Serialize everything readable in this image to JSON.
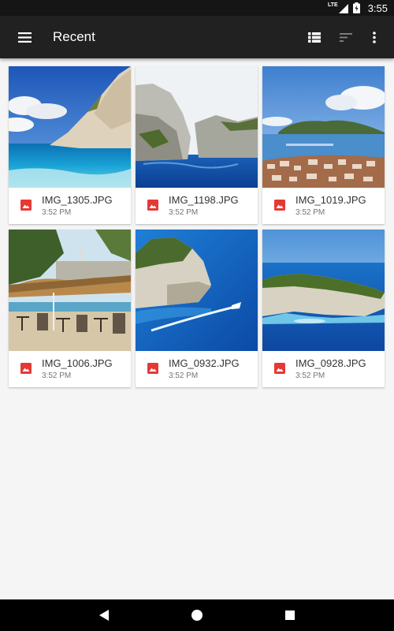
{
  "status_bar": {
    "network": "LTE",
    "time": "3:55"
  },
  "app_bar": {
    "title": "Recent"
  },
  "files": [
    {
      "name": "IMG_1305.JPG",
      "time": "3:52 PM",
      "scene": "beach-cliff"
    },
    {
      "name": "IMG_1198.JPG",
      "time": "3:52 PM",
      "scene": "cliffs-bay"
    },
    {
      "name": "IMG_1019.JPG",
      "time": "3:52 PM",
      "scene": "harbor-town"
    },
    {
      "name": "IMG_1006.JPG",
      "time": "3:52 PM",
      "scene": "cafe-terrace"
    },
    {
      "name": "IMG_0932.JPG",
      "time": "3:52 PM",
      "scene": "boat-sea"
    },
    {
      "name": "IMG_0928.JPG",
      "time": "3:52 PM",
      "scene": "shipwreck-cove"
    }
  ],
  "icons": {
    "file_type": "image-icon",
    "file_type_color": "#e53935"
  },
  "colors": {
    "app_bar": "#212121",
    "status_bar": "#151515",
    "background": "#f5f5f5",
    "nav_bar": "#000000"
  }
}
